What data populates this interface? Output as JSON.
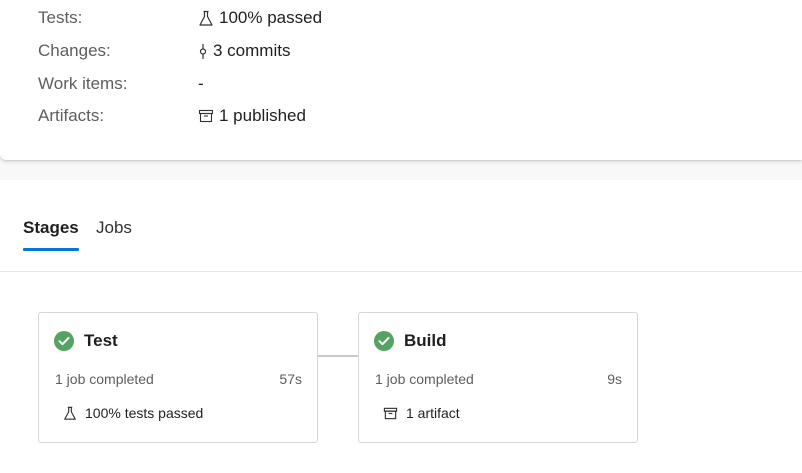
{
  "summary": {
    "rows": [
      {
        "label": "Tests:",
        "value": "100% passed",
        "icon": "flask-icon"
      },
      {
        "label": "Changes:",
        "value": "3 commits",
        "icon": "commit-icon"
      },
      {
        "label": "Work items:",
        "value": "-",
        "icon": ""
      },
      {
        "label": "Artifacts:",
        "value": "1 published",
        "icon": "artifact-icon"
      }
    ]
  },
  "tabs": [
    {
      "label": "Stages",
      "selected": true
    },
    {
      "label": "Jobs",
      "selected": false
    }
  ],
  "stages": [
    {
      "title": "Test",
      "status": "1 job completed",
      "duration": "57s",
      "detail": "100% tests passed",
      "detail_icon": "flask-icon",
      "status_icon": "success-check-icon"
    },
    {
      "title": "Build",
      "status": "1 job completed",
      "duration": "9s",
      "detail": "1 artifact",
      "detail_icon": "artifact-icon",
      "status_icon": "success-check-icon"
    }
  ],
  "colors": {
    "accent": "#0078d4",
    "success": "#55a362"
  }
}
